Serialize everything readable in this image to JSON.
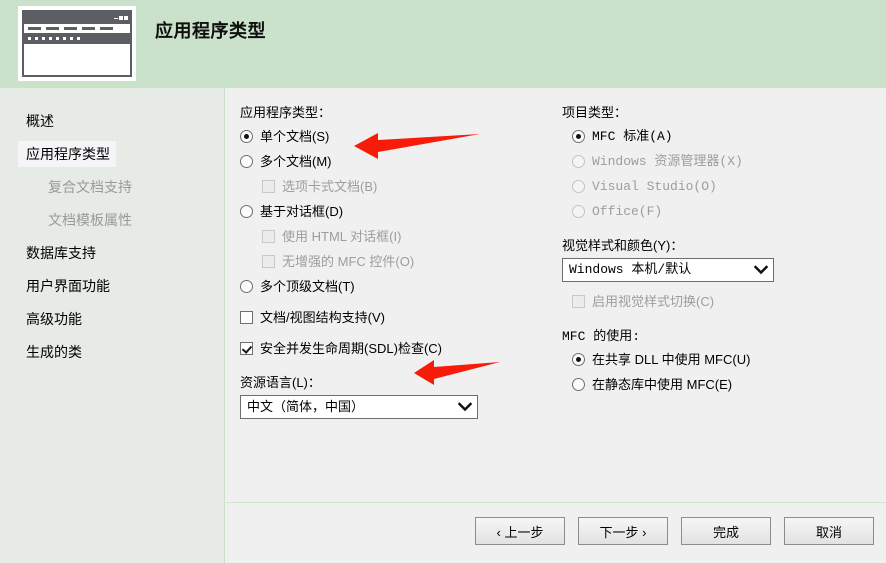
{
  "header": {
    "title": "应用程序类型",
    "icon": "app-window-icon"
  },
  "sidebar": {
    "items": [
      {
        "label": "概述",
        "state": "normal"
      },
      {
        "label": "应用程序类型",
        "state": "selected"
      },
      {
        "label": "复合文档支持",
        "state": "disabled"
      },
      {
        "label": "文档模板属性",
        "state": "disabled"
      },
      {
        "label": "数据库支持",
        "state": "normal"
      },
      {
        "label": "用户界面功能",
        "state": "normal"
      },
      {
        "label": "高级功能",
        "state": "normal"
      },
      {
        "label": "生成的类",
        "state": "normal"
      }
    ]
  },
  "main": {
    "left": {
      "app_type_label": "应用程序类型：",
      "options": [
        {
          "type": "radio",
          "label": "单个文档(S)",
          "checked": true,
          "disabled": false,
          "sub": false
        },
        {
          "type": "radio",
          "label": "多个文档(M)",
          "checked": false,
          "disabled": false,
          "sub": false
        },
        {
          "type": "checkbox",
          "label": "选项卡式文档(B)",
          "checked": false,
          "disabled": true,
          "sub": true
        },
        {
          "type": "radio",
          "label": "基于对话框(D)",
          "checked": false,
          "disabled": false,
          "sub": false
        },
        {
          "type": "checkbox",
          "label": "使用 HTML 对话框(I)",
          "checked": false,
          "disabled": true,
          "sub": true
        },
        {
          "type": "checkbox",
          "label": "无增强的 MFC 控件(O)",
          "checked": false,
          "disabled": true,
          "sub": true
        },
        {
          "type": "radio",
          "label": "多个顶级文档(T)",
          "checked": false,
          "disabled": false,
          "sub": false
        }
      ],
      "doc_view_support": {
        "type": "checkbox",
        "label": "文档/视图结构支持(V)",
        "checked": false,
        "disabled": false
      },
      "sdl_check": {
        "type": "checkbox",
        "label": "安全并发生命周期(SDL)检查(C)",
        "checked": true,
        "disabled": false
      },
      "resource_language_label": "资源语言(L)：",
      "resource_language_value": "中文（简体，中国）"
    },
    "right": {
      "project_type_label": "项目类型：",
      "project_types": [
        {
          "label": "MFC 标准(A)",
          "checked": true,
          "disabled": false
        },
        {
          "label": "Windows 资源管理器(X)",
          "checked": false,
          "disabled": true
        },
        {
          "label": "Visual Studio(O)",
          "checked": false,
          "disabled": true
        },
        {
          "label": "Office(F)",
          "checked": false,
          "disabled": true
        }
      ],
      "visual_style_label": "视觉样式和颜色(Y)：",
      "visual_style_value": "Windows 本机/默认",
      "enable_style_switch": {
        "label": "启用视觉样式切换(C)",
        "checked": false,
        "disabled": true
      },
      "mfc_usage_label": "MFC 的使用:",
      "mfc_usage": [
        {
          "label": "在共享 DLL 中使用 MFC(U)",
          "checked": true,
          "disabled": false
        },
        {
          "label": "在静态库中使用 MFC(E)",
          "checked": false,
          "disabled": false
        }
      ]
    }
  },
  "footer": {
    "buttons": [
      {
        "label": "‹ 上一步",
        "name": "back-button"
      },
      {
        "label": "下一步 ›",
        "name": "next-button"
      },
      {
        "label": "完成",
        "name": "finish-button"
      },
      {
        "label": "取消",
        "name": "cancel-button"
      }
    ]
  },
  "annotations": {
    "arrow_color": "#f71c0a",
    "arrows": [
      {
        "name": "arrow-to-single-document",
        "target": "单个文档(S)"
      },
      {
        "name": "arrow-to-doc-view-support",
        "target": "文档/视图结构支持(V)"
      }
    ]
  },
  "colors": {
    "header_bg": "#c9e2c9",
    "sidebar_bg": "#e6ece5",
    "panel_bg": "#f0f0f0",
    "selected_item_bg": "#f5f5f8",
    "accent_red": "#f71c0a"
  }
}
